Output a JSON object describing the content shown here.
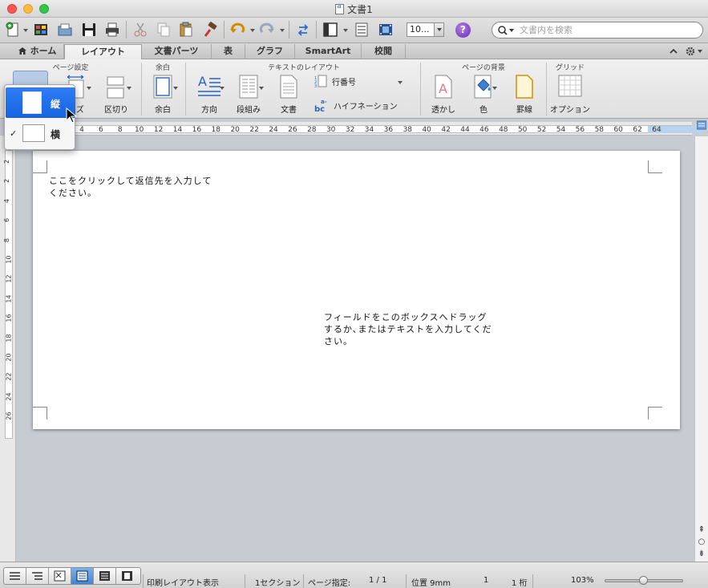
{
  "window": {
    "title": "文書1"
  },
  "toolbar": {
    "zoom_value": "10...",
    "search_placeholder": "文書内を検索",
    "help_label": "?"
  },
  "tabs": [
    {
      "label": "ホーム",
      "active": false
    },
    {
      "label": "レイアウト",
      "active": true
    },
    {
      "label": "文書パーツ",
      "active": false
    },
    {
      "label": "表",
      "active": false
    },
    {
      "label": "グラフ",
      "active": false
    },
    {
      "label": "SmartArt",
      "active": false
    },
    {
      "label": "校閲",
      "active": false
    }
  ],
  "ribbon": {
    "groups": {
      "page_setup": "ページ設定",
      "margins": "余白",
      "text_layout": "テキストのレイアウト",
      "page_background": "ページの背景",
      "grid": "グリッド"
    },
    "buttons": {
      "size": "イズ",
      "breaks": "区切り",
      "margins": "余白",
      "direction": "方向",
      "columns": "段組み",
      "document": "文書",
      "line_numbers": "行番号",
      "hyphenation": "ハイフネーション",
      "watermark": "透かし",
      "color": "色",
      "borders": "罫線",
      "options": "オプション"
    }
  },
  "ruler": {
    "h_numbers": [
      "4",
      "6",
      "8",
      "10",
      "12",
      "14",
      "16",
      "18",
      "20",
      "22",
      "24",
      "26",
      "28",
      "30",
      "32",
      "34",
      "36",
      "38",
      "40",
      "42",
      "44",
      "46",
      "48",
      "50",
      "52",
      "54",
      "56",
      "58",
      "60",
      "62",
      "64"
    ],
    "v_numbers": [
      "2",
      "2",
      "4",
      "6",
      "8",
      "10",
      "12",
      "14",
      "16",
      "18",
      "20",
      "22",
      "24",
      "26"
    ]
  },
  "document": {
    "return_address": "ここをクリックして返信先を入力してください。",
    "address_field": "フィールドをこのボックスへドラッグするか､またはテキストを入力してください。"
  },
  "orientation_menu": {
    "portrait": "縦",
    "landscape": "横",
    "selected": "landscape",
    "check": "✓"
  },
  "statusbar": {
    "view_name": "印刷レイアウト表示",
    "section": "1セクション",
    "page_label": "ページ指定:",
    "page_value": "1 / 1",
    "position": "位置 9mm",
    "line": "1",
    "column": "1 桁",
    "zoom": "103%",
    "zoom_fraction": 0.5
  },
  "colors": {
    "accent": "#1663e0",
    "ruler_margin": "#b9d3ef",
    "canvas": "#c7ccd3"
  }
}
